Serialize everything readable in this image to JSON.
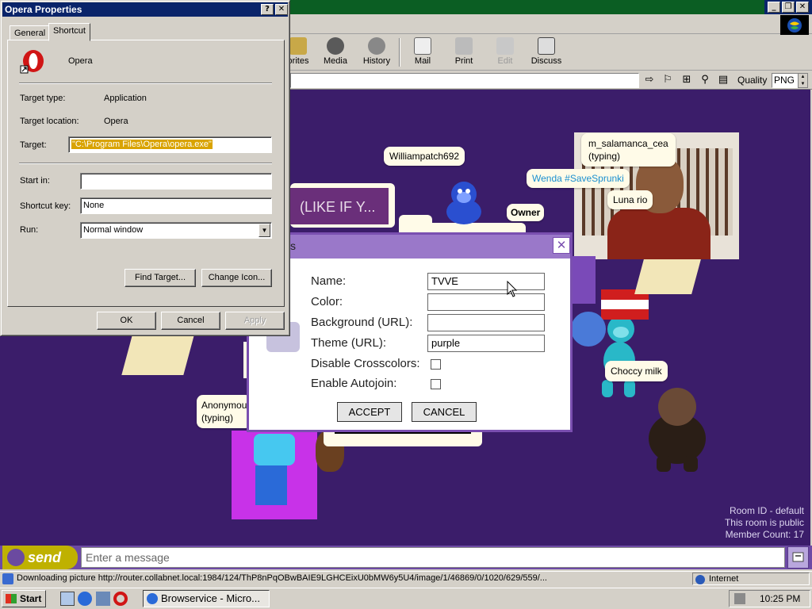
{
  "browser": {
    "window_controls": [
      "_",
      "❐",
      "✕"
    ],
    "toolbar": [
      {
        "label": "orites",
        "icon": "favorites-icon"
      },
      {
        "label": "Media",
        "icon": "media-icon"
      },
      {
        "label": "History",
        "icon": "history-icon"
      },
      {
        "label": "Mail",
        "icon": "mail-icon"
      },
      {
        "label": "Print",
        "icon": "print-icon"
      },
      {
        "label": "Edit",
        "icon": "edit-icon",
        "disabled": true
      },
      {
        "label": "Discuss",
        "icon": "discuss-icon"
      }
    ],
    "quality_label": "Quality",
    "quality_value": "PNG"
  },
  "chat": {
    "bubbles": [
      {
        "text": "Williampatch692",
        "style": "normal"
      },
      {
        "text": "m_salamanca_cea\n(typing)",
        "style": "normal"
      },
      {
        "text": "Wenda #SaveSprunki",
        "style": "blue"
      },
      {
        "text": "Luna rio",
        "style": "normal"
      },
      {
        "text": "Owner",
        "style": "normal"
      },
      {
        "text": "Choccy milk",
        "style": "normal"
      },
      {
        "text": "Anonymou\n(typing)",
        "style": "normal"
      }
    ],
    "media_caption": "(LIKE IF Y...",
    "room_info": {
      "room_id": "Room ID - default",
      "visibility": "This room is public",
      "member_count": "Member Count: 17"
    },
    "send_label": "send",
    "message_placeholder": "Enter a message"
  },
  "settings_dialog": {
    "title_fragment": "s",
    "close": "✕",
    "fields": {
      "name_label": "Name:",
      "name_value": "TVVE",
      "color_label": "Color:",
      "color_value": "",
      "background_label": "Background (URL):",
      "background_value": "",
      "theme_label": "Theme (URL):",
      "theme_value": "purple",
      "crosscolors_label": "Disable Crosscolors:",
      "autojoin_label": "Enable Autojoin:"
    },
    "accept": "ACCEPT",
    "cancel": "CANCEL"
  },
  "properties_dialog": {
    "title": "Opera Properties",
    "help": "?",
    "close": "✕",
    "tabs": [
      "General",
      "Shortcut"
    ],
    "app_name": "Opera",
    "target_type_label": "Target type:",
    "target_type_value": "Application",
    "target_location_label": "Target location:",
    "target_location_value": "Opera",
    "target_label": "Target:",
    "target_value": "\"C:\\Program Files\\Opera\\opera.exe\"",
    "start_in_label": "Start in:",
    "start_in_value": "",
    "shortcut_key_label": "Shortcut key:",
    "shortcut_key_value": "None",
    "run_label": "Run:",
    "run_value": "Normal window",
    "find_target": "Find Target...",
    "change_icon": "Change Icon...",
    "ok": "OK",
    "cancel": "Cancel",
    "apply": "Apply"
  },
  "status_bar": {
    "text": "Downloading picture http://router.collabnet.local:1984/124/ThP8nPqOBwBAIE9LGHCEixU0bMW6y5U4/image/1/46869/0/1020/629/559/...",
    "zone": "Internet"
  },
  "taskbar": {
    "start": "Start",
    "task": "Browservice - Micro...",
    "clock": "10:25 PM"
  },
  "colors": {
    "page_bg": "#3b1d6a",
    "dialog_border": "#7a4fb0",
    "send_button": "#bfb100",
    "win_title": "#0a246a",
    "win_face": "#d4d0c8"
  }
}
